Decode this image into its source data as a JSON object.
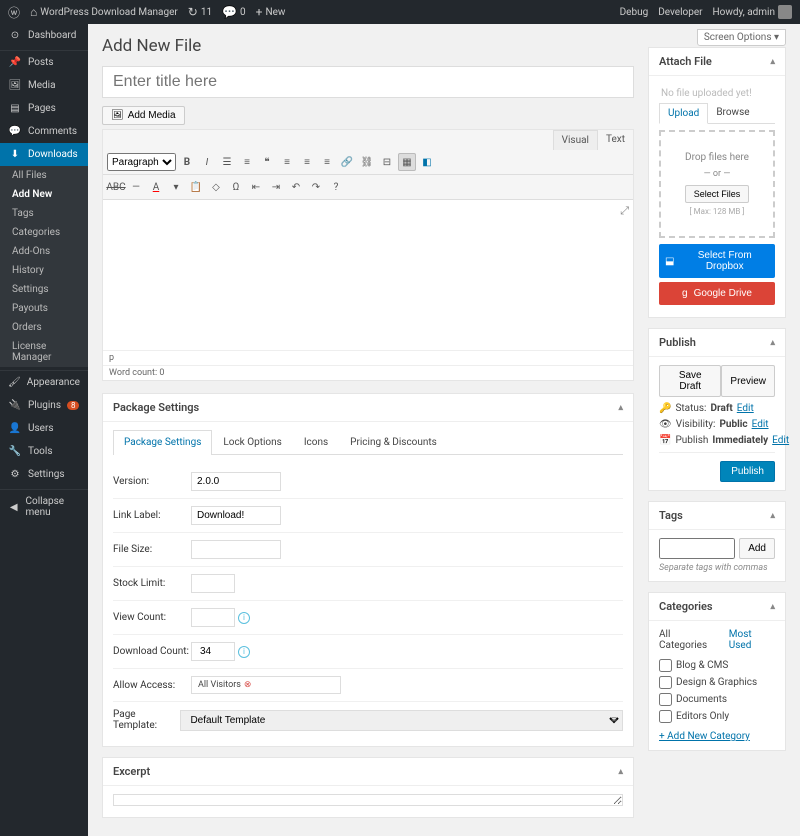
{
  "toolbar": {
    "site_name": "WordPress Download Manager",
    "updates_count": "11",
    "comments_count": "0",
    "new_label": "New",
    "debug": "Debug",
    "developer": "Developer",
    "howdy": "Howdy, admin"
  },
  "screen_options": "Screen Options ▾",
  "page_title": "Add New File",
  "title_placeholder": "Enter title here",
  "add_media": "Add Media",
  "editor_tabs": {
    "visual": "Visual",
    "text": "Text"
  },
  "format_select": "Paragraph",
  "status_path": "p",
  "word_count": "Word count: 0",
  "sidebar": {
    "dashboard": "Dashboard",
    "posts": "Posts",
    "media": "Media",
    "pages": "Pages",
    "comments": "Comments",
    "downloads": "Downloads",
    "submenu": [
      "All Files",
      "Add New",
      "Tags",
      "Categories",
      "Add-Ons",
      "History",
      "Settings",
      "Payouts",
      "Orders",
      "License Manager"
    ],
    "appearance": "Appearance",
    "plugins": "Plugins",
    "plugins_badge": "8",
    "users": "Users",
    "tools": "Tools",
    "settings": "Settings",
    "collapse": "Collapse menu"
  },
  "package_settings": {
    "title": "Package Settings",
    "tabs": [
      "Package Settings",
      "Lock Options",
      "Icons",
      "Pricing & Discounts"
    ],
    "version_label": "Version:",
    "version_value": "2.0.0",
    "link_label_label": "Link Label:",
    "link_label_value": "Download!",
    "file_size_label": "File Size:",
    "stock_label": "Stock Limit:",
    "view_count_label": "View Count:",
    "download_count_label": "Download Count:",
    "download_count_value": "34",
    "allow_access_label": "Allow Access:",
    "allow_access_value": "All Visitors",
    "page_template_label": "Page Template:",
    "page_template_value": "Default Template"
  },
  "excerpt_title": "Excerpt",
  "attach_file": {
    "title": "Attach File",
    "no_file": "No file uploaded yet!",
    "upload_tab": "Upload",
    "browse_tab": "Browse",
    "drop_text": "Drop files here",
    "or": "— or —",
    "select_files": "Select Files",
    "max": "[ Max: 128 MB ]",
    "dropbox": "Select From Dropbox",
    "gdrive": "Google Drive"
  },
  "publish": {
    "title": "Publish",
    "save_draft": "Save Draft",
    "preview": "Preview",
    "status_label": "Status:",
    "status_value": "Draft",
    "visibility_label": "Visibility:",
    "visibility_value": "Public",
    "publish_label": "Publish",
    "publish_value": "Immediately",
    "edit": "Edit",
    "submit": "Publish"
  },
  "tags": {
    "title": "Tags",
    "add": "Add",
    "hint": "Separate tags with commas"
  },
  "categories": {
    "title": "Categories",
    "all_tab": "All Categories",
    "most_used_tab": "Most Used",
    "items": [
      "Blog & CMS",
      "Design & Graphics",
      "Documents",
      "Editors Only"
    ],
    "add_new": "+ Add New Category"
  }
}
